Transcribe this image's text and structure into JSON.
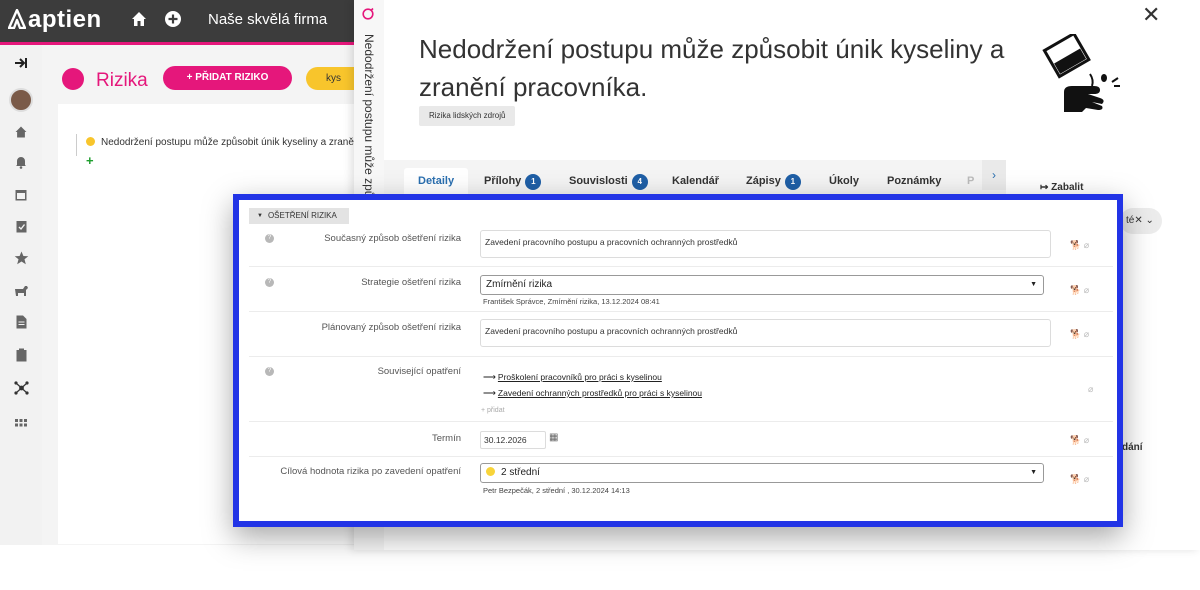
{
  "app": {
    "logo_text": "aptien",
    "company": "Naše skvělá firma"
  },
  "sidebar": {
    "items": [
      "login-icon",
      "avatar",
      "home-icon",
      "bell-icon",
      "calendar-icon",
      "clipboard-icon",
      "star-icon",
      "dog-icon",
      "document-icon",
      "clipboard-list-icon",
      "network-icon",
      "grid-icon"
    ]
  },
  "rizika": {
    "title": "Rizika",
    "add_button": "+ PŘIDAT RIZIKO",
    "search_value": "kys",
    "tree_item": "Nedodržení postupu může způsobit únik kyseliny a zranění pracovníka.",
    "tree_add": "+"
  },
  "detail": {
    "vertical_title": "Nedodržení postupu může způsobit únik kyseliny a zranění pracovníka.",
    "title": "Nedodržení postupu může způsobit únik kyseliny a zranění pracovníka.",
    "tag": "Rizika lidských zdrojů",
    "close": "✕",
    "tabs": [
      {
        "label": "Detaily",
        "badge": ""
      },
      {
        "label": "Přílohy",
        "badge": "1"
      },
      {
        "label": "Souvislosti",
        "badge": "4"
      },
      {
        "label": "Kalendář",
        "badge": ""
      },
      {
        "label": "Zápisy",
        "badge": "1"
      },
      {
        "label": "Úkoly",
        "badge": ""
      },
      {
        "label": "Poznámky",
        "badge": ""
      },
      {
        "label": "P",
        "badge": ""
      }
    ],
    "tab_next": "›",
    "collapse_label": "Zabalit",
    "right_pill": "té✕ ⌄",
    "right_text": "dání"
  },
  "section": {
    "header": "OŠETŘENÍ RIZIKA",
    "rows": {
      "current": {
        "label": "Současný způsob ošetření rizika",
        "value": "Zavedení pracovního postupu a pracovních ochranných prostředků"
      },
      "strategy": {
        "label": "Strategie ošetření rizika",
        "value": "Zmírnění rizika",
        "meta": "František Správce, Zmírnění rizika, 13.12.2024 08:41"
      },
      "planned": {
        "label": "Plánovaný způsob ošetření rizika",
        "value": "Zavedení pracovního postupu a pracovních ochranných prostředků"
      },
      "related": {
        "label": "Související opatření",
        "links": [
          "Proškolení pracovníků pro práci s kyselinou",
          "Zavedení ochranných prostředků pro práci s kyselinou"
        ],
        "add": "+ přidat"
      },
      "deadline": {
        "label": "Termín",
        "value": "30.12.2026"
      },
      "target": {
        "label": "Cílová hodnota rizika po zavedení opatření",
        "value": "2 střední",
        "meta": "Petr Bezpečák, 2 střední , 30.12.2024 14:13"
      }
    }
  },
  "colors": {
    "brand": "#e5177b",
    "accent_blue": "#1f5fa6",
    "frame": "#2234e6",
    "yellow": "#f8c52c"
  }
}
